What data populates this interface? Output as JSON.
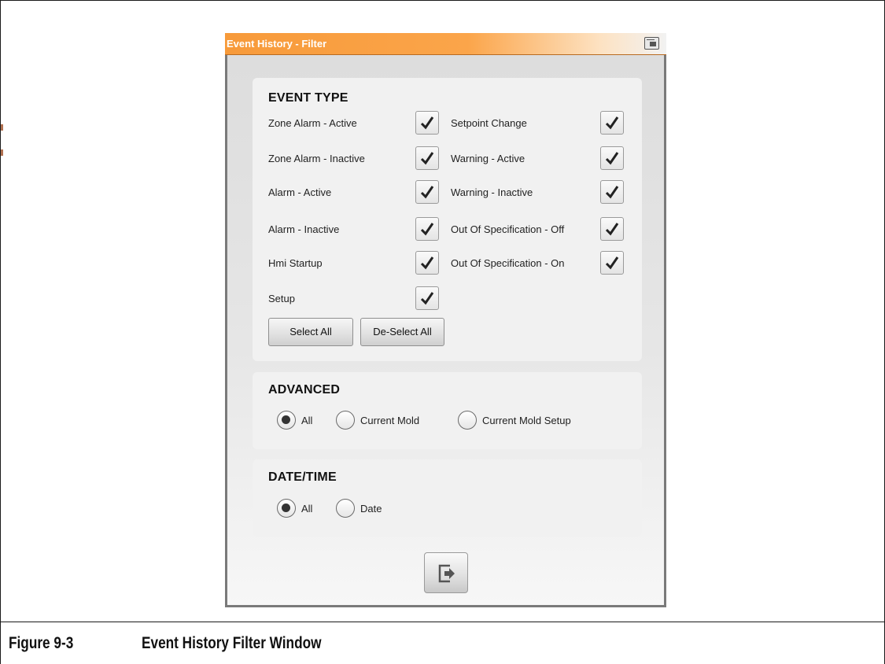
{
  "window": {
    "title": "Event History - Filter",
    "title_icon": "window-restore-icon",
    "accent_color": "#f79a3a"
  },
  "event_type": {
    "heading": "EVENT TYPE",
    "left_items": [
      {
        "label": "Zone Alarm - Active",
        "checked": true
      },
      {
        "label": "Zone Alarm - Inactive",
        "checked": true
      },
      {
        "label": "Alarm - Active",
        "checked": true
      },
      {
        "label": "Alarm - Inactive",
        "checked": true
      },
      {
        "label": "Hmi Startup",
        "checked": true
      },
      {
        "label": "Setup",
        "checked": true
      }
    ],
    "right_items": [
      {
        "label": "Setpoint Change",
        "checked": true
      },
      {
        "label": "Warning - Active",
        "checked": true
      },
      {
        "label": "Warning - Inactive",
        "checked": true
      },
      {
        "label": "Out Of Specification - Off",
        "checked": true
      },
      {
        "label": "Out Of Specification - On",
        "checked": true
      }
    ],
    "select_all_label": "Select All",
    "deselect_all_label": "De-Select All"
  },
  "advanced": {
    "heading": "ADVANCED",
    "options": [
      {
        "label": "All",
        "selected": true
      },
      {
        "label": "Current Mold",
        "selected": false
      },
      {
        "label": "Current Mold Setup",
        "selected": false
      }
    ]
  },
  "datetime": {
    "heading": "DATE/TIME",
    "options": [
      {
        "label": "All",
        "selected": true
      },
      {
        "label": "Date",
        "selected": false
      }
    ]
  },
  "exit_button": {
    "icon": "exit-icon"
  },
  "caption": {
    "number": "Figure 9-3",
    "title": "Event History Filter Window"
  }
}
